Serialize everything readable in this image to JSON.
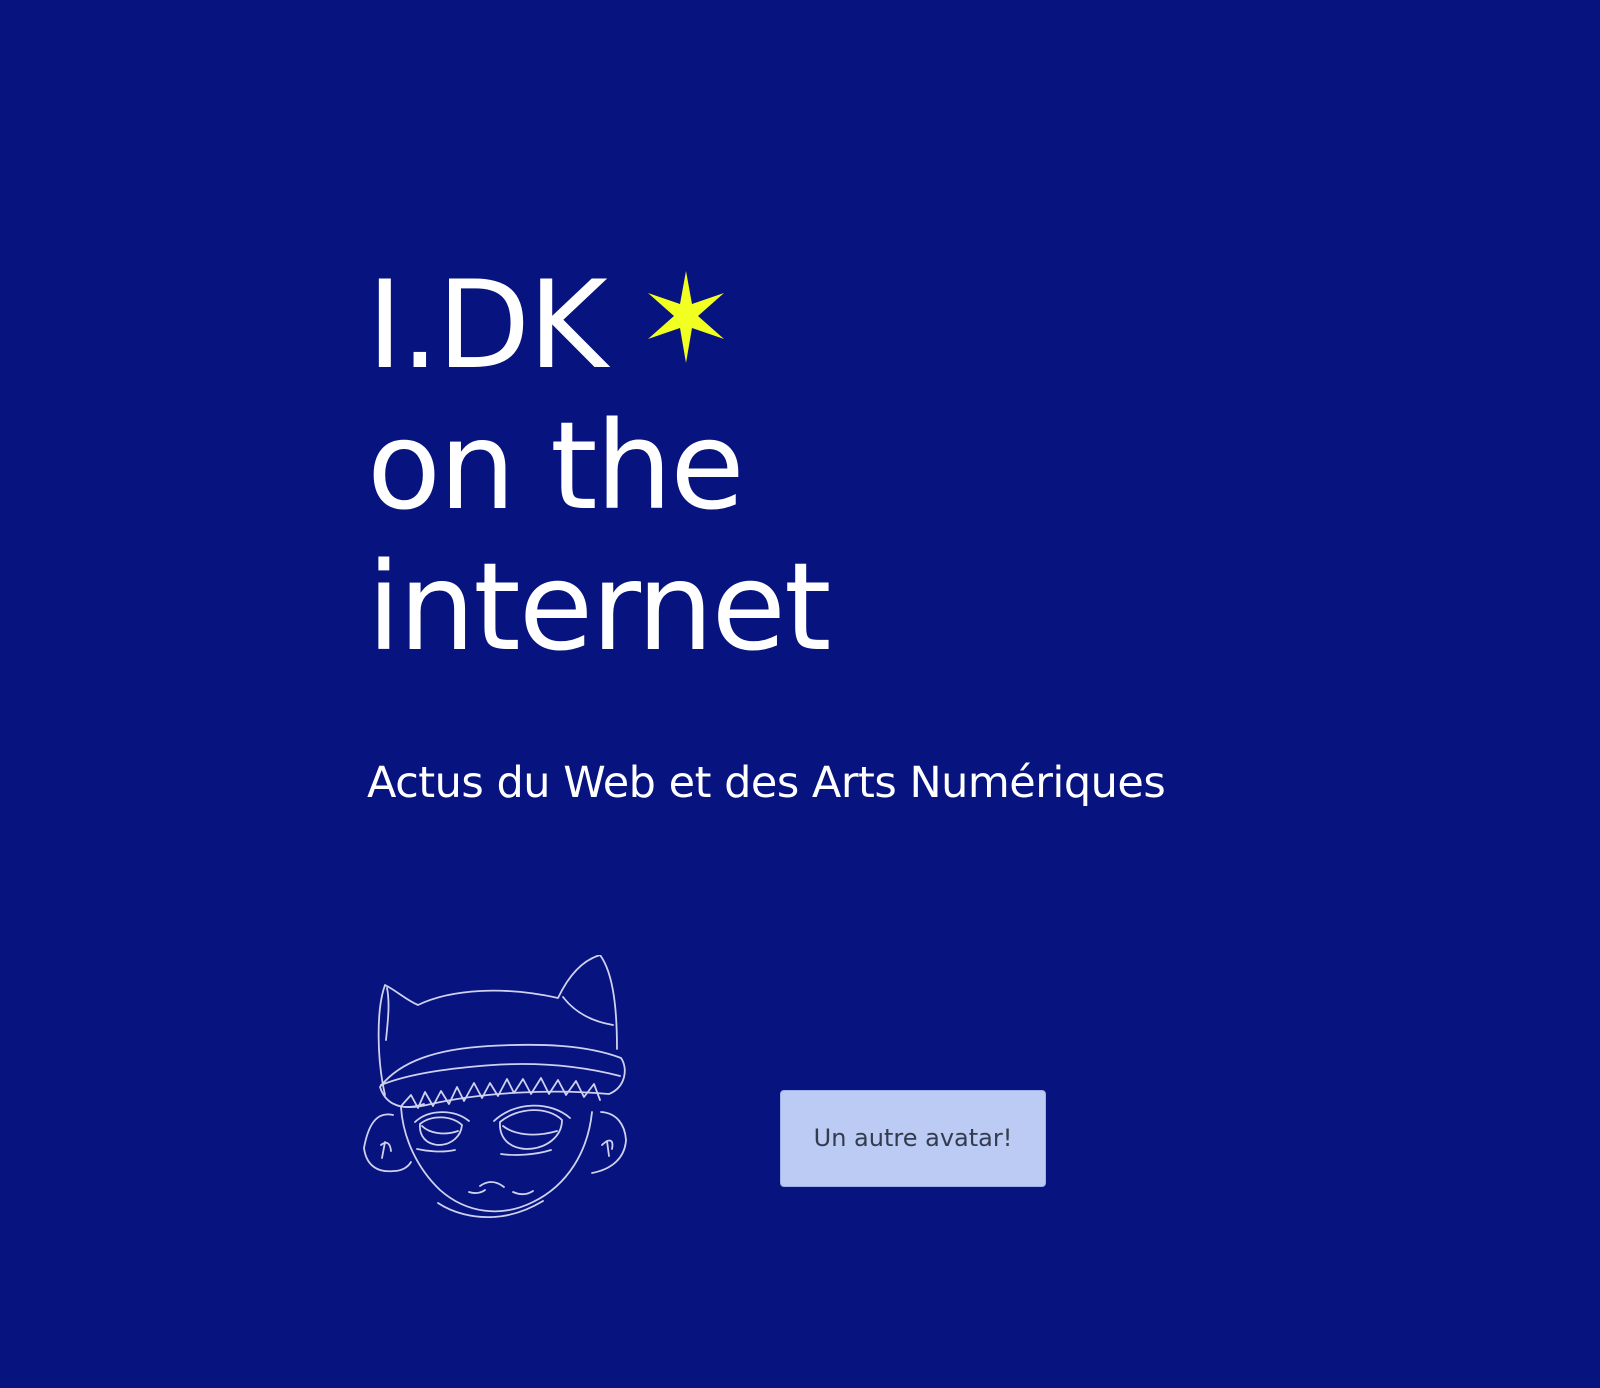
{
  "header": {
    "title_line_1": "I.DK",
    "title_line_2": "on the",
    "title_line_3": "internet",
    "star_icon": "six-point-star-icon",
    "star_color": "#f1ff21"
  },
  "tagline": "Actus du Web et des Arts Numériques",
  "avatar": {
    "icon": "sketched-avatar-icon",
    "line_color": "#d9dcf6"
  },
  "actions": {
    "another_avatar_label": "Un autre avatar!"
  },
  "theme": {
    "background": "#07137e",
    "button_background": "#bccbf3",
    "text": "#ffffff"
  }
}
